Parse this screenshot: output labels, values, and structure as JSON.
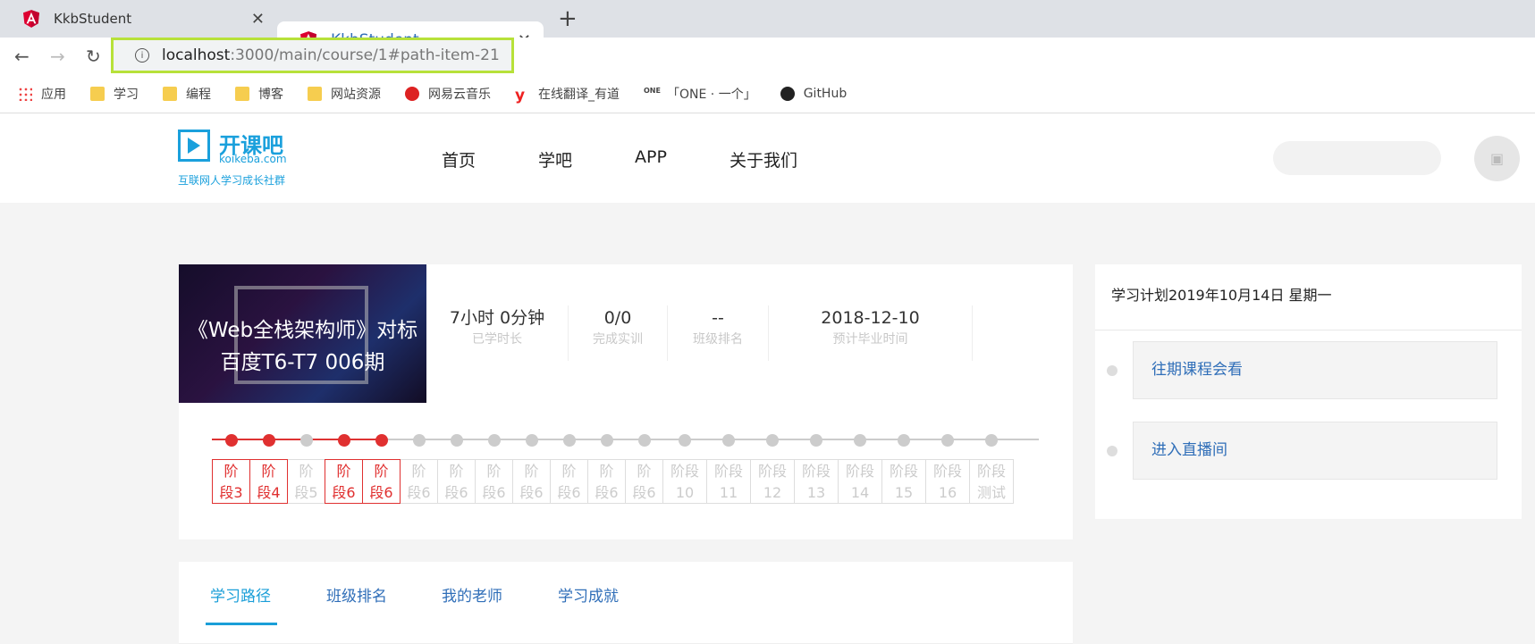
{
  "browser": {
    "tabs": [
      {
        "title": "KkbStudent"
      },
      {
        "title": "KkbStudent"
      }
    ],
    "new_tab": "+",
    "url_host": "localhost",
    "url_rest": ":3000/main/course/1#path-item-21",
    "bookmarks": [
      "应用",
      "学习",
      "编程",
      "博客",
      "网站资源",
      "网易云音乐",
      "在线翻译_有道",
      "「ONE · 一个」",
      "GitHub"
    ]
  },
  "site": {
    "logo_brand": "开课吧",
    "logo_domain": "koikeba.com",
    "logo_slogan": "互联网人学习成长社群",
    "nav": [
      "首页",
      "学吧",
      "APP",
      "关于我们"
    ],
    "accent": "#1aa0dc"
  },
  "course": {
    "title_line1": "《Web全栈架构师》对标",
    "title_line2": "百度T6-T7 006期",
    "stats": [
      {
        "value": "7小时 0分钟",
        "label": "已学时长"
      },
      {
        "value": "0/0",
        "label": "完成实训"
      },
      {
        "value": "--",
        "label": "班级排名"
      },
      {
        "value": "2018-12-10",
        "label": "预计毕业时间"
      }
    ],
    "stages": [
      {
        "line1": "阶",
        "line2": "段3",
        "done": true
      },
      {
        "line1": "阶",
        "line2": "段4",
        "done": true
      },
      {
        "line1": "阶",
        "line2": "段5",
        "done": false
      },
      {
        "line1": "阶",
        "line2": "段6",
        "done": true
      },
      {
        "line1": "阶",
        "line2": "段6",
        "done": true
      },
      {
        "line1": "阶",
        "line2": "段6",
        "done": false
      },
      {
        "line1": "阶",
        "line2": "段6",
        "done": false
      },
      {
        "line1": "阶",
        "line2": "段6",
        "done": false
      },
      {
        "line1": "阶",
        "line2": "段6",
        "done": false
      },
      {
        "line1": "阶",
        "line2": "段6",
        "done": false
      },
      {
        "line1": "阶",
        "line2": "段6",
        "done": false
      },
      {
        "line1": "阶",
        "line2": "段6",
        "done": false
      },
      {
        "line1": "阶段",
        "line2": "10",
        "done": false
      },
      {
        "line1": "阶段",
        "line2": "11",
        "done": false
      },
      {
        "line1": "阶段",
        "line2": "12",
        "done": false
      },
      {
        "line1": "阶段",
        "line2": "13",
        "done": false
      },
      {
        "line1": "阶段",
        "line2": "14",
        "done": false
      },
      {
        "line1": "阶段",
        "line2": "15",
        "done": false
      },
      {
        "line1": "阶段",
        "line2": "16",
        "done": false
      },
      {
        "line1": "阶段",
        "line2": "测试",
        "done": false
      }
    ],
    "done_color": "#e03030"
  },
  "plan": {
    "title": "学习计划2019年10月14日 星期一",
    "items": [
      "往期课程会看",
      "进入直播间"
    ]
  },
  "section_tabs": [
    "学习路径",
    "班级排名",
    "我的老师",
    "学习成就"
  ]
}
